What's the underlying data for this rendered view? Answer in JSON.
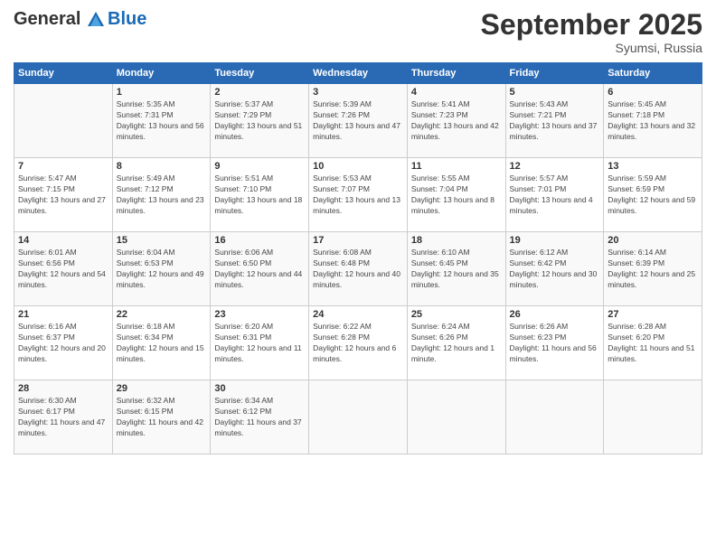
{
  "header": {
    "logo_line1": "General",
    "logo_line2": "Blue",
    "title": "September 2025",
    "location": "Syumsi, Russia"
  },
  "weekdays": [
    "Sunday",
    "Monday",
    "Tuesday",
    "Wednesday",
    "Thursday",
    "Friday",
    "Saturday"
  ],
  "weeks": [
    [
      {
        "day": "",
        "sunrise": "",
        "sunset": "",
        "daylight": ""
      },
      {
        "day": "1",
        "sunrise": "Sunrise: 5:35 AM",
        "sunset": "Sunset: 7:31 PM",
        "daylight": "Daylight: 13 hours and 56 minutes."
      },
      {
        "day": "2",
        "sunrise": "Sunrise: 5:37 AM",
        "sunset": "Sunset: 7:29 PM",
        "daylight": "Daylight: 13 hours and 51 minutes."
      },
      {
        "day": "3",
        "sunrise": "Sunrise: 5:39 AM",
        "sunset": "Sunset: 7:26 PM",
        "daylight": "Daylight: 13 hours and 47 minutes."
      },
      {
        "day": "4",
        "sunrise": "Sunrise: 5:41 AM",
        "sunset": "Sunset: 7:23 PM",
        "daylight": "Daylight: 13 hours and 42 minutes."
      },
      {
        "day": "5",
        "sunrise": "Sunrise: 5:43 AM",
        "sunset": "Sunset: 7:21 PM",
        "daylight": "Daylight: 13 hours and 37 minutes."
      },
      {
        "day": "6",
        "sunrise": "Sunrise: 5:45 AM",
        "sunset": "Sunset: 7:18 PM",
        "daylight": "Daylight: 13 hours and 32 minutes."
      }
    ],
    [
      {
        "day": "7",
        "sunrise": "Sunrise: 5:47 AM",
        "sunset": "Sunset: 7:15 PM",
        "daylight": "Daylight: 13 hours and 27 minutes."
      },
      {
        "day": "8",
        "sunrise": "Sunrise: 5:49 AM",
        "sunset": "Sunset: 7:12 PM",
        "daylight": "Daylight: 13 hours and 23 minutes."
      },
      {
        "day": "9",
        "sunrise": "Sunrise: 5:51 AM",
        "sunset": "Sunset: 7:10 PM",
        "daylight": "Daylight: 13 hours and 18 minutes."
      },
      {
        "day": "10",
        "sunrise": "Sunrise: 5:53 AM",
        "sunset": "Sunset: 7:07 PM",
        "daylight": "Daylight: 13 hours and 13 minutes."
      },
      {
        "day": "11",
        "sunrise": "Sunrise: 5:55 AM",
        "sunset": "Sunset: 7:04 PM",
        "daylight": "Daylight: 13 hours and 8 minutes."
      },
      {
        "day": "12",
        "sunrise": "Sunrise: 5:57 AM",
        "sunset": "Sunset: 7:01 PM",
        "daylight": "Daylight: 13 hours and 4 minutes."
      },
      {
        "day": "13",
        "sunrise": "Sunrise: 5:59 AM",
        "sunset": "Sunset: 6:59 PM",
        "daylight": "Daylight: 12 hours and 59 minutes."
      }
    ],
    [
      {
        "day": "14",
        "sunrise": "Sunrise: 6:01 AM",
        "sunset": "Sunset: 6:56 PM",
        "daylight": "Daylight: 12 hours and 54 minutes."
      },
      {
        "day": "15",
        "sunrise": "Sunrise: 6:04 AM",
        "sunset": "Sunset: 6:53 PM",
        "daylight": "Daylight: 12 hours and 49 minutes."
      },
      {
        "day": "16",
        "sunrise": "Sunrise: 6:06 AM",
        "sunset": "Sunset: 6:50 PM",
        "daylight": "Daylight: 12 hours and 44 minutes."
      },
      {
        "day": "17",
        "sunrise": "Sunrise: 6:08 AM",
        "sunset": "Sunset: 6:48 PM",
        "daylight": "Daylight: 12 hours and 40 minutes."
      },
      {
        "day": "18",
        "sunrise": "Sunrise: 6:10 AM",
        "sunset": "Sunset: 6:45 PM",
        "daylight": "Daylight: 12 hours and 35 minutes."
      },
      {
        "day": "19",
        "sunrise": "Sunrise: 6:12 AM",
        "sunset": "Sunset: 6:42 PM",
        "daylight": "Daylight: 12 hours and 30 minutes."
      },
      {
        "day": "20",
        "sunrise": "Sunrise: 6:14 AM",
        "sunset": "Sunset: 6:39 PM",
        "daylight": "Daylight: 12 hours and 25 minutes."
      }
    ],
    [
      {
        "day": "21",
        "sunrise": "Sunrise: 6:16 AM",
        "sunset": "Sunset: 6:37 PM",
        "daylight": "Daylight: 12 hours and 20 minutes."
      },
      {
        "day": "22",
        "sunrise": "Sunrise: 6:18 AM",
        "sunset": "Sunset: 6:34 PM",
        "daylight": "Daylight: 12 hours and 15 minutes."
      },
      {
        "day": "23",
        "sunrise": "Sunrise: 6:20 AM",
        "sunset": "Sunset: 6:31 PM",
        "daylight": "Daylight: 12 hours and 11 minutes."
      },
      {
        "day": "24",
        "sunrise": "Sunrise: 6:22 AM",
        "sunset": "Sunset: 6:28 PM",
        "daylight": "Daylight: 12 hours and 6 minutes."
      },
      {
        "day": "25",
        "sunrise": "Sunrise: 6:24 AM",
        "sunset": "Sunset: 6:26 PM",
        "daylight": "Daylight: 12 hours and 1 minute."
      },
      {
        "day": "26",
        "sunrise": "Sunrise: 6:26 AM",
        "sunset": "Sunset: 6:23 PM",
        "daylight": "Daylight: 11 hours and 56 minutes."
      },
      {
        "day": "27",
        "sunrise": "Sunrise: 6:28 AM",
        "sunset": "Sunset: 6:20 PM",
        "daylight": "Daylight: 11 hours and 51 minutes."
      }
    ],
    [
      {
        "day": "28",
        "sunrise": "Sunrise: 6:30 AM",
        "sunset": "Sunset: 6:17 PM",
        "daylight": "Daylight: 11 hours and 47 minutes."
      },
      {
        "day": "29",
        "sunrise": "Sunrise: 6:32 AM",
        "sunset": "Sunset: 6:15 PM",
        "daylight": "Daylight: 11 hours and 42 minutes."
      },
      {
        "day": "30",
        "sunrise": "Sunrise: 6:34 AM",
        "sunset": "Sunset: 6:12 PM",
        "daylight": "Daylight: 11 hours and 37 minutes."
      },
      {
        "day": "",
        "sunrise": "",
        "sunset": "",
        "daylight": ""
      },
      {
        "day": "",
        "sunrise": "",
        "sunset": "",
        "daylight": ""
      },
      {
        "day": "",
        "sunrise": "",
        "sunset": "",
        "daylight": ""
      },
      {
        "day": "",
        "sunrise": "",
        "sunset": "",
        "daylight": ""
      }
    ]
  ]
}
